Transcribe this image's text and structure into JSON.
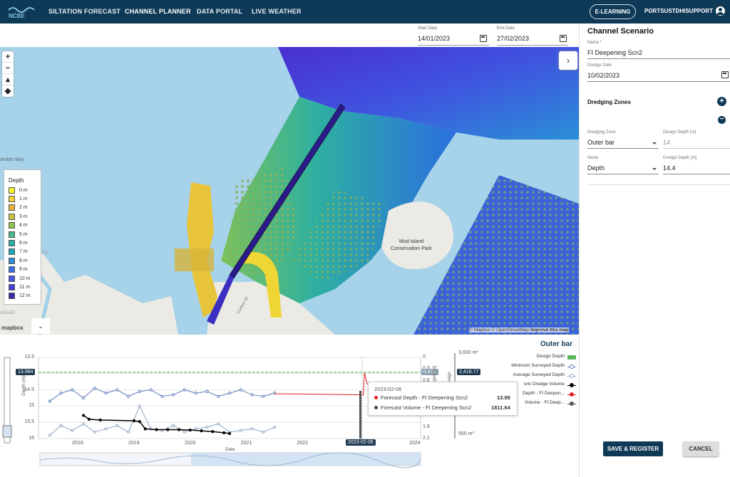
{
  "nav": {
    "logo_text": "NCBE",
    "items": [
      "SILTATION FORECAST",
      "CHANNEL PLANNER",
      "DATA PORTAL",
      "LIVE WEATHER"
    ],
    "elearning": "E-LEARNING",
    "user": "PORTSUSTDHISUPPORT"
  },
  "dates": {
    "start_label": "Start Date",
    "start_value": "14/01/2023",
    "end_label": "End Date",
    "end_value": "27/02/2023"
  },
  "map": {
    "place_labels": [
      "amble Bay",
      "Mud Island\nConservation Park",
      "Curlew St",
      "EE",
      "UDGEE"
    ],
    "mud_island": "Mud Island",
    "conservation": "Conservation Park",
    "left_bay": "amble Bay",
    "street": "Curlew St",
    "edge1": "EE",
    "edge2": "UDGEE",
    "attribution": "© Mapbox © OpenStreetMap",
    "improve": "Improve this map",
    "mapbox": "mapbox",
    "legend_title": "Depth",
    "legend": [
      {
        "label": "0 m",
        "color": "#f6f22c"
      },
      {
        "label": "1 m",
        "color": "#f2d335"
      },
      {
        "label": "2 m",
        "color": "#e8b33c"
      },
      {
        "label": "3 m",
        "color": "#c9c43d"
      },
      {
        "label": "4 m",
        "color": "#8fc04a"
      },
      {
        "label": "5 m",
        "color": "#48b98a"
      },
      {
        "label": "6 m",
        "color": "#2aaea3"
      },
      {
        "label": "7 m",
        "color": "#1ea3bd"
      },
      {
        "label": "8 m",
        "color": "#2b8bd6"
      },
      {
        "label": "9 m",
        "color": "#3a6fe0"
      },
      {
        "label": "10 m",
        "color": "#4657e0"
      },
      {
        "label": "11 m",
        "color": "#4a3fd3"
      },
      {
        "label": "12 m",
        "color": "#3b2aa6"
      }
    ]
  },
  "panel": {
    "title": "Channel Scenario",
    "name_label": "Name *",
    "name_value": "FI Deepening Scn2",
    "dredge_label": "Dredge Date",
    "dredge_value": "10/02/2023",
    "zones_label": "Dredging Zones",
    "zone_label": "Dredging Zone",
    "zone_value": "Outer bar",
    "design_label": "Design Depth [m]",
    "design_value": "14",
    "mode_label": "Mode",
    "mode_value": "Depth",
    "dredge_depth_label": "Dredge Depth [m]",
    "dredge_depth_value": "14.4",
    "save": "SAVE & REGISTER",
    "cancel": "CANCEL"
  },
  "chart_data": {
    "type": "line",
    "title": "Outer bar",
    "xlabel": "Date",
    "ylabel": "Depth (m)",
    "ylabel_right": "Dredged [m]",
    "ylabel_right2": "Volume Design",
    "x_ticks": [
      "2018",
      "2019",
      "2020",
      "2021",
      "2022",
      "2023",
      "2024"
    ],
    "y_ticks": [
      "13.5",
      "14",
      "14.5",
      "15",
      "15.5",
      "16"
    ],
    "y2_ticks": [
      "0",
      "0.3",
      "0.6",
      "0.9",
      "1.2",
      "1.5",
      "1.8",
      "2.1"
    ],
    "y3_ticks": [
      "3,000 m³",
      "500 m³"
    ],
    "ylim": [
      13.5,
      16
    ],
    "highlight_depth": "13.984",
    "highlight_dredged": "0.470",
    "highlight_volume": "2,418.77",
    "cursor_date": "2023-02-06",
    "legend": [
      {
        "name": "Design Depth",
        "color": "#5cb85c"
      },
      {
        "name": "Minimum Surveyed Depth",
        "color": "#5b79b8"
      },
      {
        "name": "Average Surveyed Depth",
        "color": "#8fa5c0"
      },
      {
        "name": "oric Dredge Volume",
        "color": "#000000"
      },
      {
        "name": "Depth - FI Deepen...",
        "color": "#e32020"
      },
      {
        "name": "Volume - FI Deep...",
        "color": "#555555"
      }
    ],
    "tooltip": {
      "date": "2023-02-06",
      "rows": [
        {
          "label": "Forecast Depth - FI Deepening Scn2",
          "value": "13.98",
          "color": "#e32020"
        },
        {
          "label": "Forecast Volume - FI Deepening Scn2",
          "value": "1811.64",
          "color": "#444444"
        }
      ]
    },
    "series": [
      {
        "name": "Minimum Surveyed Depth",
        "x": [
          2017.5,
          2017.7,
          2017.9,
          2018.1,
          2018.3,
          2018.5,
          2018.7,
          2018.9,
          2019.1,
          2019.3,
          2019.5,
          2019.7,
          2019.9,
          2020.1,
          2020.3,
          2020.5,
          2020.7,
          2020.9,
          2021.1,
          2021.3,
          2021.5
        ],
        "values": [
          14.85,
          14.6,
          14.5,
          14.75,
          14.45,
          14.6,
          14.5,
          14.7,
          14.55,
          14.5,
          14.7,
          14.65,
          14.5,
          14.6,
          14.55,
          14.7,
          14.6,
          14.5,
          14.65,
          14.7,
          14.6
        ]
      },
      {
        "name": "Average Surveyed Depth",
        "x": [
          2017.5,
          2017.7,
          2017.9,
          2018.1,
          2018.3,
          2018.5,
          2018.7,
          2018.9,
          2019.1,
          2019.3,
          2019.5,
          2019.7,
          2019.9,
          2020.1,
          2020.3,
          2020.5,
          2020.7,
          2020.9,
          2021.1,
          2021.3,
          2021.5
        ],
        "values": [
          15.9,
          15.6,
          15.75,
          15.55,
          15.8,
          15.7,
          15.6,
          15.8,
          15.0,
          15.7,
          15.75,
          15.6,
          15.8,
          15.7,
          15.65,
          15.55,
          15.8,
          15.75,
          15.7,
          15.8,
          15.65
        ]
      },
      {
        "name": "Forecast Depth - FI Deepening Scn2",
        "x": [
          2021.5,
          2022.0,
          2022.5,
          2023.0,
          2023.08,
          2023.1,
          2023.15,
          2023.4
        ],
        "values": [
          14.62,
          14.63,
          14.64,
          14.65,
          14.66,
          13.98,
          14.32,
          14.33
        ]
      },
      {
        "name": "Historic Dredge Volume",
        "x": [
          2018.1,
          2018.2,
          2018.4,
          2019.0,
          2019.1,
          2019.2,
          2019.4,
          2019.6,
          2019.8,
          2020.0,
          2020.2,
          2020.4,
          2020.6,
          2020.7
        ],
        "values": [
          1.5,
          1.6,
          1.62,
          1.64,
          1.66,
          1.85,
          1.87,
          1.87,
          1.87,
          1.88,
          1.9,
          1.92,
          1.95,
          1.97
        ]
      }
    ]
  }
}
